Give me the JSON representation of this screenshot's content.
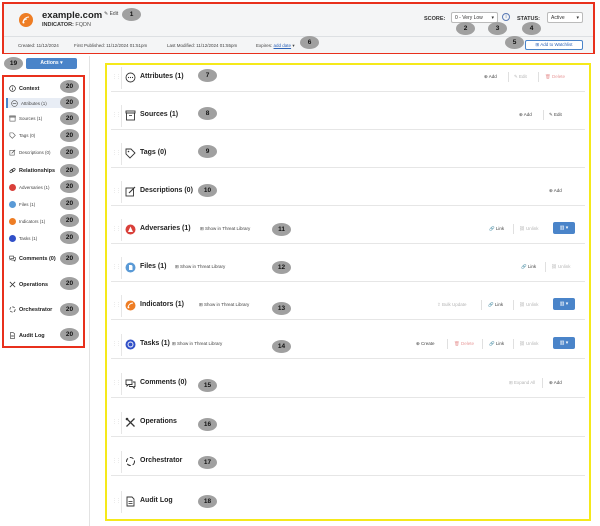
{
  "header": {
    "title": "example.com",
    "edit_label": "Edit",
    "indicator_label": "INDICATOR:",
    "indicator_type": "FQDN",
    "score_label": "SCORE:",
    "score_value": "0 - Very Low",
    "status_label": "STATUS:",
    "status_value": "Active",
    "created": "Created: 11/12/2024",
    "first_published": "First Published: 11/12/2024 01:51pm",
    "last_modified": "Last Modified: 11/12/2024 01:55pm",
    "expires_label": "Expires:",
    "expires_link": "add date",
    "watchlist_label": "Add to Watchlist",
    "brand_color": "#ee7d24",
    "accent_color": "#4a84c9"
  },
  "markers": [
    "1",
    "2",
    "3",
    "4",
    "5",
    "6",
    "7",
    "8",
    "9",
    "10",
    "11",
    "12",
    "13",
    "14",
    "15",
    "16",
    "17",
    "18",
    "19",
    "20"
  ],
  "sidebar": {
    "actions_label": "Actions",
    "context_label": "Context",
    "attributes": "Attributes (1)",
    "sources": "Sources (1)",
    "tags": "Tags (0)",
    "descriptions": "Descriptions (0)",
    "relationships_label": "Relationships",
    "adversaries": "Adversaries (1)",
    "files": "Files (1)",
    "indicators": "Indicators (1)",
    "tasks": "Tasks (1)",
    "comments": "Comments (0)",
    "operations": "Operations",
    "orchestrator": "Orchestrator",
    "audit_log": "Audit Log"
  },
  "sections": {
    "attributes": "Attributes (1)",
    "sources": "Sources (1)",
    "tags": "Tags (0)",
    "descriptions": "Descriptions (0)",
    "adversaries": "Adversaries (1)",
    "files": "Files (1)",
    "indicators": "Indicators (1)",
    "tasks": "Tasks (1)",
    "comments": "Comments (0)",
    "operations": "Operations",
    "orchestrator": "Orchestrator",
    "audit_log": "Audit Log"
  },
  "actions": {
    "add": "Add",
    "edit": "Edit",
    "delete": "Delete",
    "link": "Link",
    "unlink": "Unlink",
    "create": "Create",
    "bulk_update": "Bulk Update",
    "expand_all": "Expand All",
    "show_in_tl": "Show in Threat Library"
  }
}
